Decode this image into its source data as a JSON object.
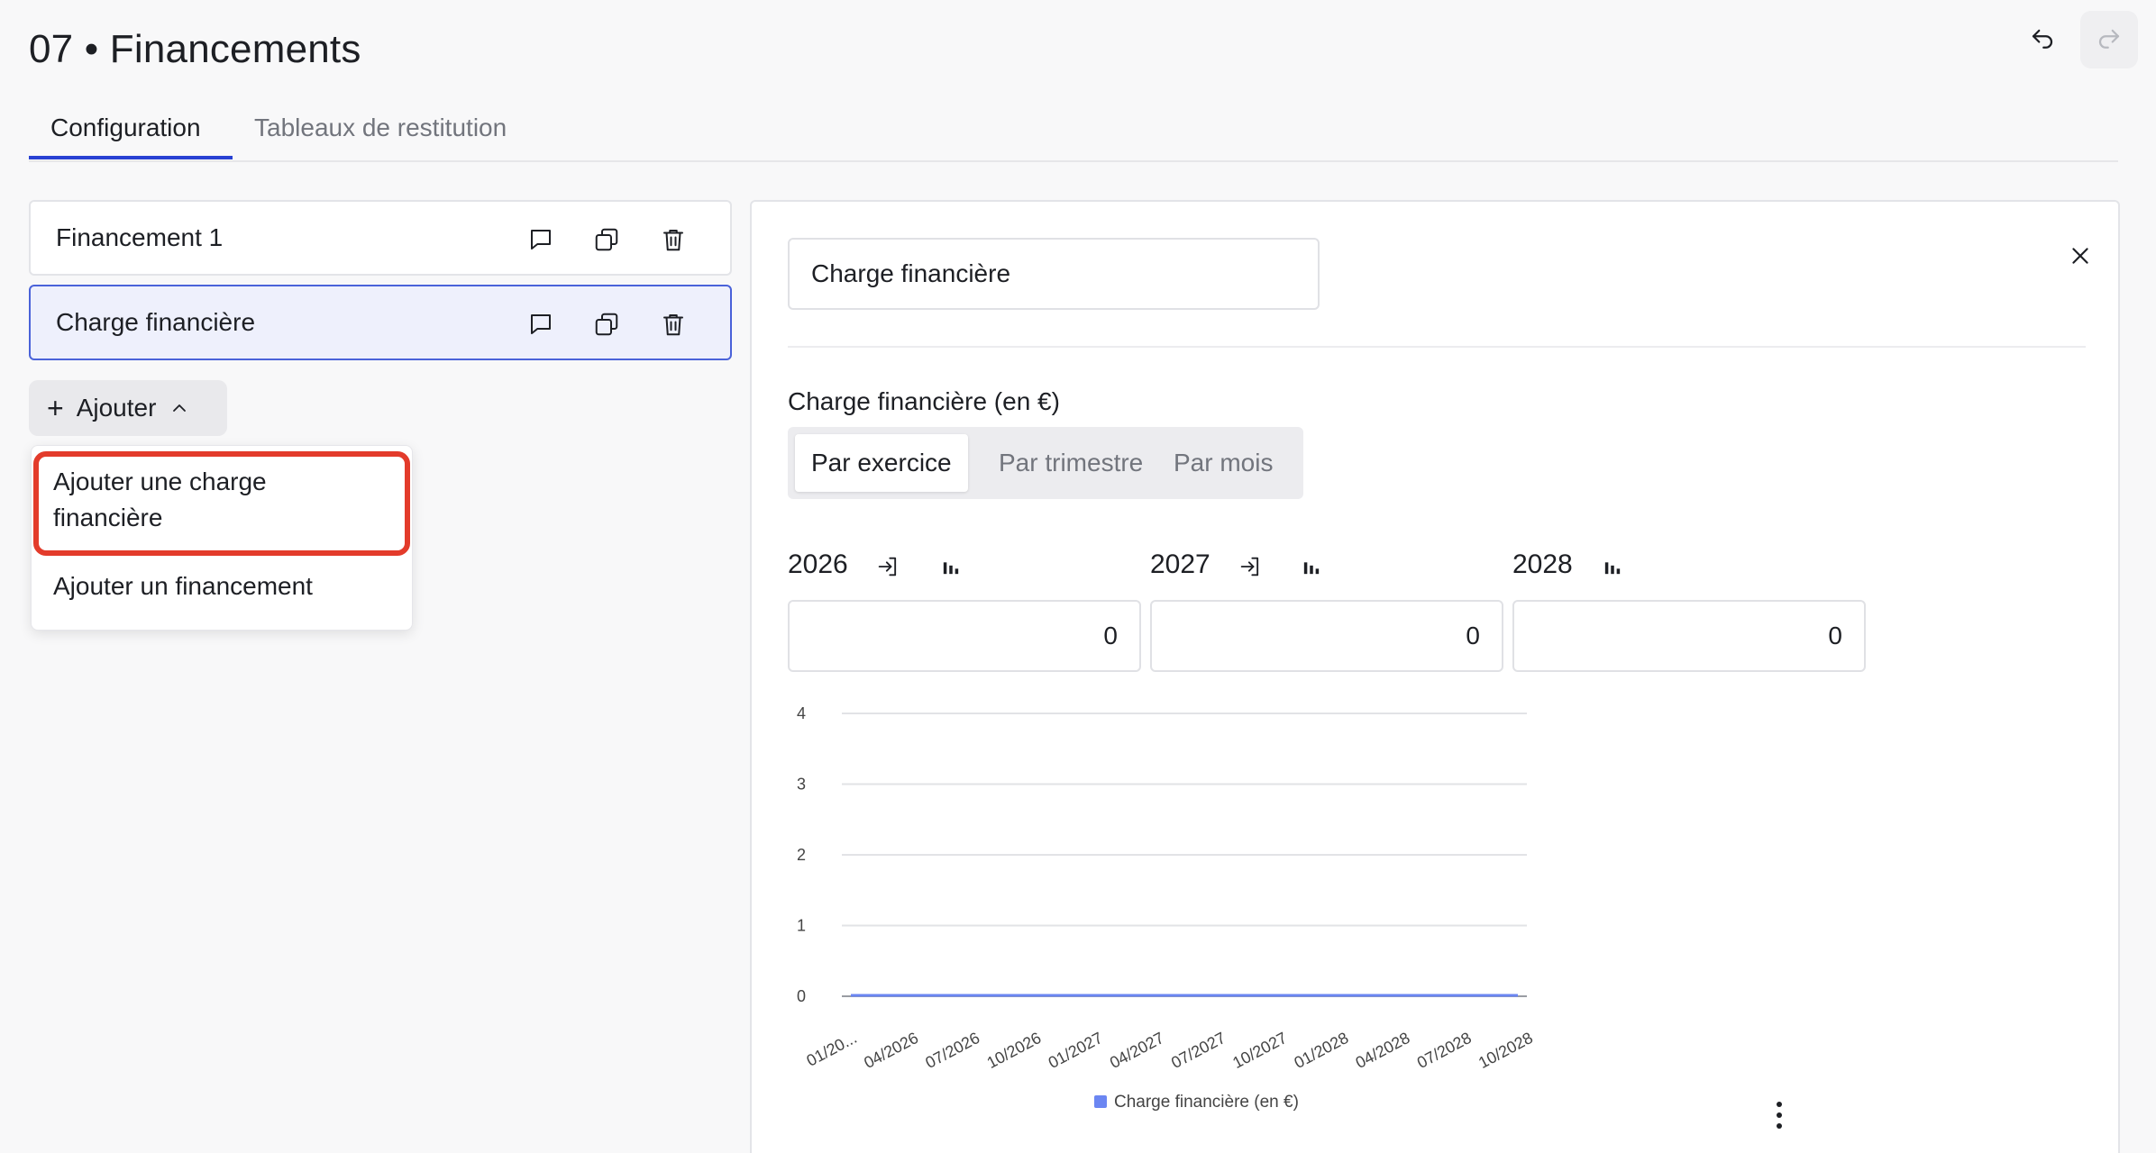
{
  "page": {
    "title": "07 • Financements"
  },
  "header": {
    "undo_icon": "undo-icon",
    "redo_icon": "redo-icon"
  },
  "tabs": [
    {
      "label": "Configuration",
      "active": true
    },
    {
      "label": "Tableaux de restitution",
      "active": false
    }
  ],
  "list": {
    "items": [
      {
        "label": "Financement 1",
        "selected": false
      },
      {
        "label": "Charge financière",
        "selected": true
      }
    ],
    "item_icons": [
      "comment-icon",
      "duplicate-icon",
      "trash-icon"
    ]
  },
  "add_button": {
    "label": "Ajouter"
  },
  "add_menu": {
    "items": [
      {
        "label": "Ajouter une charge financière",
        "highlighted": true
      },
      {
        "label": "Ajouter un financement",
        "highlighted": false
      }
    ]
  },
  "detail": {
    "name_value": "Charge financière",
    "field_label": "Charge financière (en €)",
    "segments": [
      {
        "label": "Par exercice",
        "active": true
      },
      {
        "label": "Par trimestre",
        "active": false
      },
      {
        "label": "Par mois",
        "active": false
      }
    ],
    "years": [
      {
        "year": "2026",
        "value": "0"
      },
      {
        "year": "2027",
        "value": "0"
      },
      {
        "year": "2028",
        "value": "0"
      }
    ]
  },
  "chart_data": {
    "type": "line",
    "title": "",
    "xlabel": "",
    "ylabel": "",
    "x": [
      "01/20...",
      "04/2026",
      "07/2026",
      "10/2026",
      "01/2027",
      "04/2027",
      "07/2027",
      "10/2027",
      "01/2028",
      "04/2028",
      "07/2028",
      "10/2028"
    ],
    "yticks": [
      "0",
      "1",
      "2",
      "3",
      "4"
    ],
    "ylim": [
      0,
      4
    ],
    "grid": true,
    "legend_position": "bottom",
    "series": [
      {
        "name": "Charge financière (en €)",
        "values": [
          0,
          0,
          0,
          0,
          0,
          0,
          0,
          0,
          0,
          0,
          0,
          0
        ],
        "color": "#6b86f2"
      }
    ]
  },
  "colors": {
    "accent": "#2841d3",
    "selected_bg": "#eef0fc",
    "highlight": "#e33b2b"
  }
}
